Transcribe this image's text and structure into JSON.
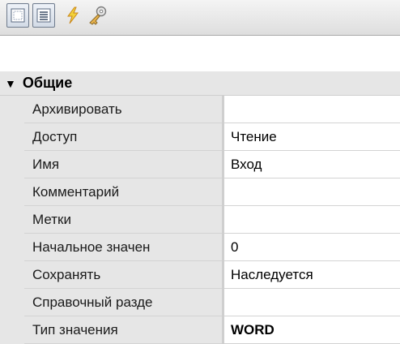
{
  "toolbar": {
    "buttons": [
      {
        "icon": "categorized-icon",
        "pressed": true
      },
      {
        "icon": "alphabetical-icon",
        "pressed": true
      },
      {
        "icon": "events-lightning-icon",
        "pressed": false
      },
      {
        "icon": "property-pages-key-icon",
        "pressed": false
      }
    ]
  },
  "category": {
    "label": "Общие",
    "expanded": true
  },
  "properties": [
    {
      "name": "Архивировать",
      "value": ""
    },
    {
      "name": "Доступ",
      "value": "Чтение"
    },
    {
      "name": "Имя",
      "value": "Вход"
    },
    {
      "name": "Комментарий",
      "value": ""
    },
    {
      "name": "Метки",
      "value": ""
    },
    {
      "name": "Начальное значен",
      "value": "0"
    },
    {
      "name": "Сохранять",
      "value": "Наследуется"
    },
    {
      "name": "Справочный разде",
      "value": ""
    },
    {
      "name": "Тип значения",
      "value": "WORD"
    }
  ],
  "colors": {
    "category_bg": "#e6e6e6",
    "value_bg": "#ffffff",
    "grid_line": "#d3d3d3"
  }
}
